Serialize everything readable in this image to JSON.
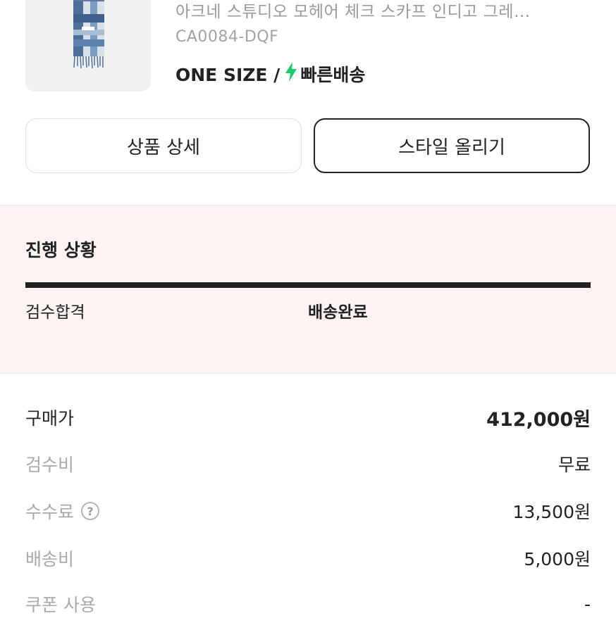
{
  "product": {
    "name": "아크네 스튜디오 모헤어 체크 스카프 인디고 그레...",
    "code": "CA0084-DQF",
    "size": "ONE SIZE /",
    "bolt_icon": "lightning-bolt-icon",
    "bolt_color": "#1fc96b",
    "delivery": "빠른배송"
  },
  "buttons": {
    "detail_label": "상품 상세",
    "style_label": "스타일 올리기"
  },
  "progress": {
    "title": "진행 상황",
    "steps": [
      "검수합격",
      "배송완료"
    ],
    "background": "#fdf4f2"
  },
  "price": {
    "rows": [
      {
        "label": "구매가",
        "value": "412,000원"
      },
      {
        "label": "검수비",
        "value": "무료"
      },
      {
        "label": "수수료",
        "value": "13,500원",
        "help_icon": "question-circle-icon",
        "help_text": "?"
      },
      {
        "label": "배송비",
        "value": "5,000원"
      },
      {
        "label": "쿠폰 사용",
        "value": "-"
      }
    ]
  }
}
